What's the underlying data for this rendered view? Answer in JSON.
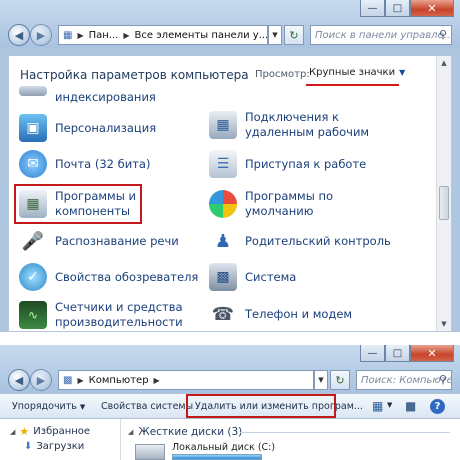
{
  "win1": {
    "breadcrumb": [
      "Пан...",
      "Все элементы панели у..."
    ],
    "search_placeholder": "Поиск в панели управле...",
    "title": "Настройка параметров компьютера",
    "view_label": "Просмотр:",
    "view_value": "Крупные значки",
    "items": [
      {
        "label": "индексирования",
        "icon": "indexing-icon"
      },
      {
        "label": "Персонализация",
        "icon": "personalization-icon"
      },
      {
        "label": "Почта (32 бита)",
        "icon": "mail-icon"
      },
      {
        "label": "Программы и",
        "label2": "компоненты",
        "icon": "programs-icon"
      },
      {
        "label": "Распознавание речи",
        "icon": "microphone-icon"
      },
      {
        "label": "Свойства обозревателя",
        "icon": "internet-options-icon"
      },
      {
        "label": "Счетчики и средства",
        "label2": "производительности",
        "icon": "performance-icon"
      },
      {
        "label": "Подключения к",
        "label2": "удаленным рабочим",
        "icon": "remote-desktop-icon"
      },
      {
        "label": "Приступая к работе",
        "icon": "getting-started-icon"
      },
      {
        "label": "Программы по",
        "label2": "умолчанию",
        "icon": "default-programs-icon"
      },
      {
        "label": "Родительский контроль",
        "icon": "parental-control-icon"
      },
      {
        "label": "Система",
        "icon": "system-icon"
      },
      {
        "label": "Телефон и модем",
        "icon": "phone-modem-icon"
      }
    ],
    "colors": {
      "highlight": "#c21a1a",
      "link": "#1a3f7a"
    }
  },
  "win2": {
    "breadcrumb": [
      "Компьютер"
    ],
    "search_placeholder": "Поиск: Компьютер",
    "toolbar": {
      "organize": "Упорядочить",
      "system_props": "Свойства системы",
      "uninstall": "Удалить или изменить програм..."
    },
    "sidebar": {
      "favorites": "Избранное",
      "downloads": "Загрузки"
    },
    "group_header": "Жесткие диски (3)",
    "drive_label": "Локальный диск (C:)"
  }
}
